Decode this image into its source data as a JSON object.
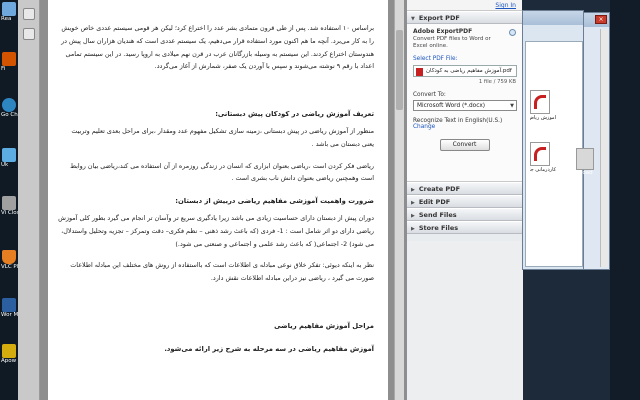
{
  "desktop": {
    "icons": [
      {
        "label": "Rea",
        "color": "#6fa8dc"
      },
      {
        "label": "Fi",
        "color": "#d35400"
      },
      {
        "label": "Go Ch",
        "color": "#2e86c1"
      },
      {
        "label": "Uk",
        "color": "#5dade2"
      },
      {
        "label": "Vi Clos",
        "color": "#a0a0a0"
      },
      {
        "label": "VLC Pl",
        "color": "#e67e22"
      },
      {
        "label": "Wor Mi",
        "color": "#2c5fa0"
      },
      {
        "label": "Apow",
        "color": "#d4ac0d"
      }
    ],
    "right_icon_label": "nload"
  },
  "document": {
    "paragraphs": [
      "براساس ۱۰ استفاده شد. پس از طی قرون متمادی بشر عدد را اختراع کرد؛ لیکن هر قومی سیستم عددی خاص خویش را به کار می‌برد. آنچه ما هم اکنون مورد استفاده قرار می‌دهیم، یک سیستم عددی است که هندیان هزاران سال پیش در هندوستان اختراع کردند. این سیستم به وسیله بازرگانان عرب در قرن نهم میلادی به اروپا رسید. در این سیستم تمامی اعداد با رقم ۹ نوشته می‌شوند و سپس با آوردن یک صفر، شمارش از آغاز می‌گردد."
    ],
    "heading1": "تعریف آموزش ریاضی در کودکان پیش دبستانی:",
    "para2": "منظور از آموزش ریاضی در پیش دبستانی ،زمینه سازی تشکیل مفهوم عدد ومقدار ،برای مراحل بعدی تعلیم وتربیت یعنی دبستان می باشد .",
    "para3": "ریاضی فکر کردن است ،ریاضی بعنوان ابزاری که انسان در زندگی روزمره از آن استفاده می کند،ریاضی بیان روابط است وهمچنین ریاضی بعنوان دانش ناب بشری است .",
    "heading2": "ضرورت واهمیت آموزشی مفاهیم ریاضی دربیش از دبستان:",
    "para4": "دوران پیش از دبستان دارای حساسیت زیادی می باشد زیرا یادگیری سریع تر وآسان تر انجام می گیرد بطور کلی آموزش ریاضی دارای دو اثر شامل است : 1- فردی (که باعث رشد ذهنی – نظم فکری– دقت وتمرکز – تجزیه وتحلیل واستدلال، می شود) 2- اجتماعی( که باعث رشد علمی و اجتماعی و صنعتی می شود.)",
    "para5": "نظر به اینکه دیوئی: تفکر خلاق نوعی مبادله ی اطلاعات است که بااستفاده از روش های مختلف این مبادله اطلاعات صورت می گیرد ، ریاضی نیز دراین مبادله اطلاعات نقش دارد.",
    "heading3": "مراحل آموزش مفاهیم ریاضی",
    "para6": "آموزش مفاهیم ریاضی در سه مرحله به شرح زیر ارائه می‌شود."
  },
  "panel": {
    "sign_in": "Sign In",
    "export_header": "Export PDF",
    "product_title": "Adobe ExportPDF",
    "product_desc": "Convert PDF files to Word or Excel online.",
    "select_file_link": "Select PDF File:",
    "file_name": "آموزش مفاهیم ریاضی به کودکان.pdf",
    "file_info": "1 file / 759 KB",
    "convert_to_label": "Convert To:",
    "convert_to_value": "Microsoft Word (*.docx)",
    "recognize_text": "Recognize Text in English(U.S.)",
    "change_link": "Change",
    "convert_button": "Convert",
    "sections": [
      "Create PDF",
      "Edit PDF",
      "Send Files",
      "Store Files"
    ]
  },
  "explorer": {
    "files": [
      "آموزش ریاض...",
      "کاردرمانی جلسه بیا..."
    ]
  }
}
